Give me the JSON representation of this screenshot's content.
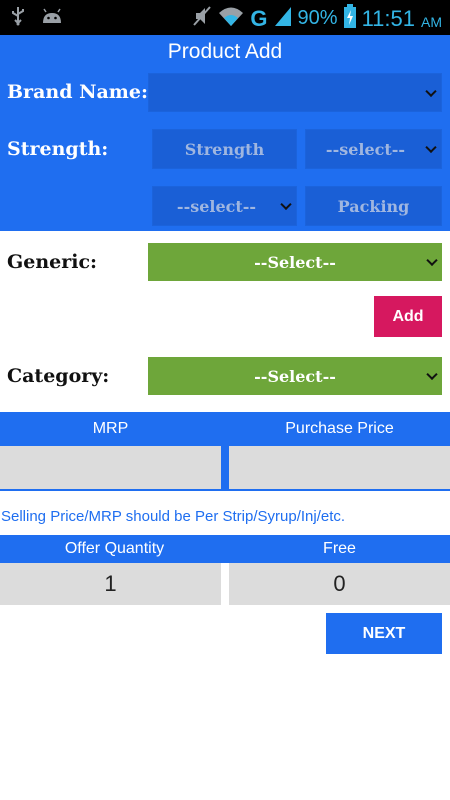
{
  "status_bar": {
    "icons": [
      "usb-icon",
      "android-icon",
      "mute-icon",
      "wifi-icon",
      "signal-icon",
      "battery-charging-icon"
    ],
    "network_type": "G",
    "battery_percent": "90%",
    "time": "11:51",
    "ampm": "AM",
    "color": "#33b5e5"
  },
  "header": {
    "title": "Product Add"
  },
  "form": {
    "brand_name_label": "Brand Name:",
    "brand_name_value": "",
    "strength_label": "Strength:",
    "strength_placeholder": "Strength",
    "strength_unit_select": "--select--",
    "packing_unit_select": "--select--",
    "packing_placeholder": "Packing",
    "generic_label": "Generic:",
    "generic_select": "--Select--",
    "add_label": "Add",
    "category_label": "Category:",
    "category_select": "--Select--"
  },
  "price": {
    "mrp_label": "MRP",
    "purchase_label": "Purchase Price",
    "mrp_value": "",
    "purchase_value": ""
  },
  "note": "Selling Price/MRP should be Per Strip/Syrup/Inj/etc.",
  "offer": {
    "quantity_label": "Offer Quantity",
    "free_label": "Free",
    "quantity_value": "1",
    "free_value": "0"
  },
  "next_label": "NEXT",
  "colors": {
    "primary_blue": "#1f6ef0",
    "green": "#6ea63a",
    "add_pink": "#d6185f",
    "field_gray": "#dcdcdc"
  }
}
